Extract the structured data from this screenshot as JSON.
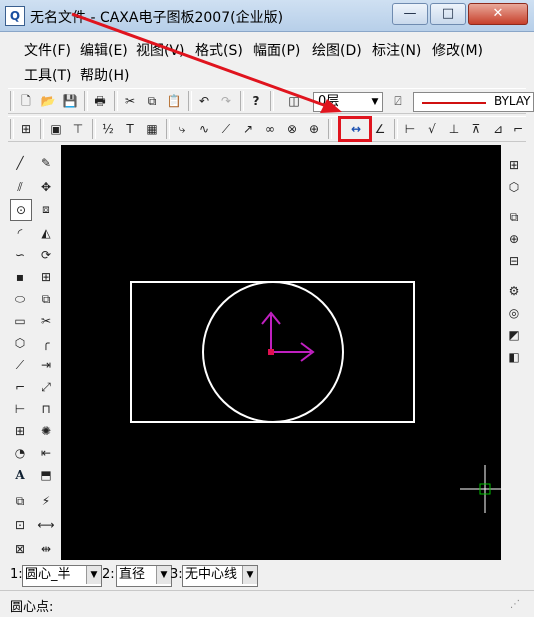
{
  "window": {
    "title": "无名文件 - CAXA电子图板2007(企业版)",
    "app_icon": "Q",
    "minimize_glyph": "—",
    "maximize_glyph": "□",
    "close_glyph": "✕"
  },
  "menu": [
    "文件(F)",
    "编辑(E)",
    "视图(V)",
    "格式(S)",
    "幅面(P)",
    "绘图(D)",
    "标注(N)",
    "修改(M)",
    "工具(T)",
    "帮助(H)"
  ],
  "toolbar1": {
    "layer": "0层",
    "linetype": "BYLAY",
    "dropdown_glyph": "▼"
  },
  "options": {
    "items": [
      {
        "num": "1:",
        "value": "圆心_半"
      },
      {
        "num": "2:",
        "value": "直径"
      },
      {
        "num": "3:",
        "value": "无中心线"
      }
    ],
    "arrow_glyph": "▼"
  },
  "status": {
    "prompt": "圆心点:"
  },
  "colors": {
    "canvas": "#000000",
    "highlight": "#e0141e",
    "annotation_arrow": "#e0141e",
    "coord_axis": "#c020c0",
    "drawing_line": "#ffffff",
    "crosshair": "#ffffff",
    "cursor_box": "#00c000"
  }
}
